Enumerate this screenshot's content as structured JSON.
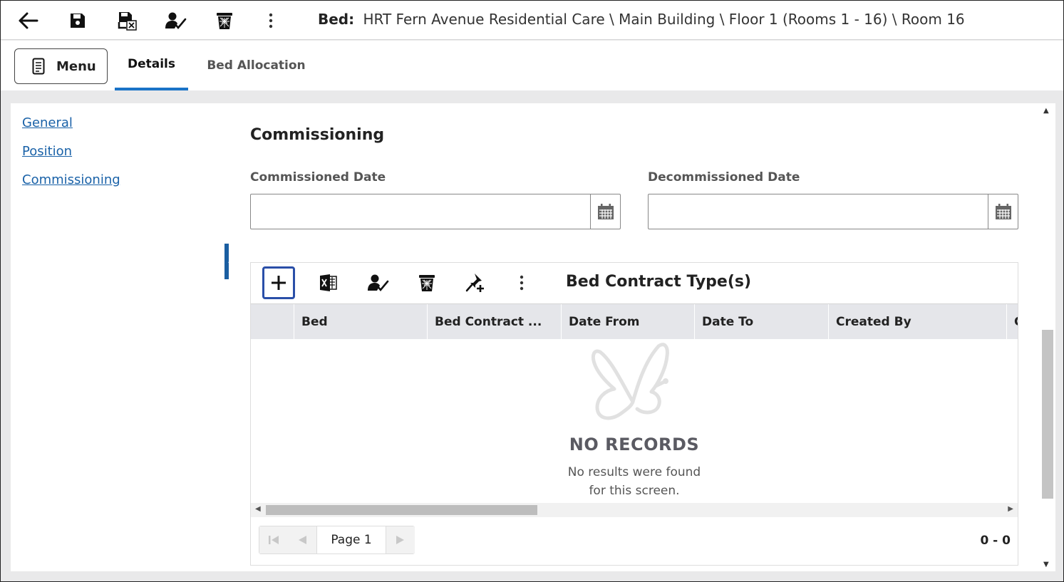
{
  "toolbar": {
    "icons": [
      "back-arrow-icon",
      "save-icon",
      "save-close-icon",
      "assign-user-icon",
      "delete-icon",
      "more-vert-icon"
    ]
  },
  "title": {
    "label": "Bed:",
    "path": "HRT Fern Avenue Residential Care \\ Main Building \\ Floor 1 (Rooms 1 - 16) \\ Room 16"
  },
  "tabs": {
    "menu_label": "Menu",
    "items": [
      {
        "label": "Details",
        "active": true
      },
      {
        "label": "Bed Allocation",
        "active": false
      }
    ]
  },
  "sidenav": {
    "items": [
      {
        "label": "General"
      },
      {
        "label": "Position"
      },
      {
        "label": "Commissioning"
      }
    ]
  },
  "section": {
    "title": "Commissioning",
    "commissioned_label": "Commissioned Date",
    "commissioned_value": "",
    "decommissioned_label": "Decommissioned Date",
    "decommissioned_value": ""
  },
  "grid": {
    "title": "Bed Contract Type(s)",
    "columns": [
      "Bed",
      "Bed Contract ...",
      "Date From",
      "Date To",
      "Created By",
      "C"
    ],
    "empty_title": "NO RECORDS",
    "empty_line1": "No results were found",
    "empty_line2": "for this screen.",
    "page_label": "Page 1",
    "count": "0 - 0"
  },
  "colors": {
    "accent": "#1a73c7",
    "link": "#1a62a8",
    "focus": "#2a4fa8",
    "header_bg": "#e5e6ea"
  }
}
